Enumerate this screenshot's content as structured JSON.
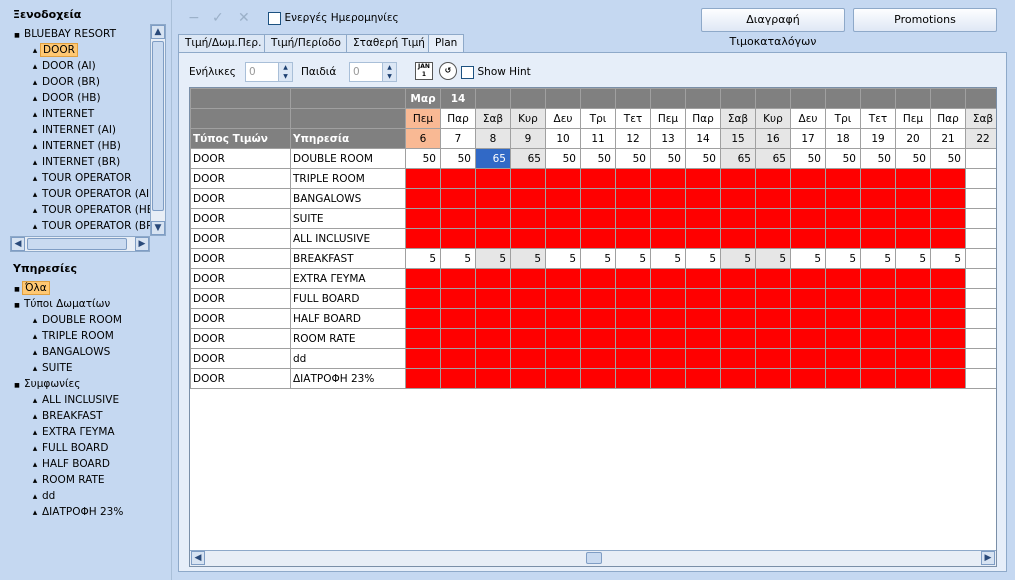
{
  "left": {
    "hotels_title": "Ξενοδοχεία",
    "hotel_tree": [
      {
        "label": "BLUEBAY RESORT",
        "level": 0,
        "selected": false
      },
      {
        "label": "DOOR",
        "level": 1,
        "selected": true
      },
      {
        "label": "DOOR (AI)",
        "level": 1,
        "selected": false
      },
      {
        "label": "DOOR (BR)",
        "level": 1,
        "selected": false
      },
      {
        "label": "DOOR (HB)",
        "level": 1,
        "selected": false
      },
      {
        "label": "INTERNET",
        "level": 1,
        "selected": false
      },
      {
        "label": "INTERNET  (AI)",
        "level": 1,
        "selected": false
      },
      {
        "label": "INTERNET  (HB)",
        "level": 1,
        "selected": false
      },
      {
        "label": "INTERNET (BR)",
        "level": 1,
        "selected": false
      },
      {
        "label": "TOUR OPERATOR",
        "level": 1,
        "selected": false
      },
      {
        "label": "TOUR OPERATOR  (AI",
        "level": 1,
        "selected": false
      },
      {
        "label": "TOUR OPERATOR  (HE",
        "level": 1,
        "selected": false
      },
      {
        "label": "TOUR OPERATOR  (BR)",
        "level": 1,
        "selected": false
      }
    ],
    "services_title": "Υπηρεσίες",
    "services_tree": [
      {
        "label": "Όλα",
        "level": 0,
        "selected": true
      },
      {
        "label": "Τύποι Δωματίων",
        "level": 0,
        "selected": false
      },
      {
        "label": "DOUBLE ROOM",
        "level": 1,
        "selected": false
      },
      {
        "label": "TRIPLE ROOM",
        "level": 1,
        "selected": false
      },
      {
        "label": "BANGALOWS",
        "level": 1,
        "selected": false
      },
      {
        "label": "SUITE",
        "level": 1,
        "selected": false
      },
      {
        "label": "Συμφωνίες",
        "level": 0,
        "selected": false
      },
      {
        "label": "ALL INCLUSIVE",
        "level": 1,
        "selected": false
      },
      {
        "label": "BREAKFAST",
        "level": 1,
        "selected": false
      },
      {
        "label": "EXTRA ΓΕΥΜΑ",
        "level": 1,
        "selected": false
      },
      {
        "label": "FULL BOARD",
        "level": 1,
        "selected": false
      },
      {
        "label": "HALF BOARD",
        "level": 1,
        "selected": false
      },
      {
        "label": "ROOM RATE",
        "level": 1,
        "selected": false
      },
      {
        "label": "dd",
        "level": 1,
        "selected": false
      },
      {
        "label": "ΔΙΑΤΡΟΦΗ 23%",
        "level": 1,
        "selected": false
      }
    ]
  },
  "toolbar": {
    "active_dates_label": "Ενεργές Ημερομηνίες",
    "delete_pricelists_label": "Διαγραφή Τιμοκαταλόγων",
    "promotions_label": "Promotions"
  },
  "tabs": [
    "Τιμή/Δωμ.Περ.",
    "Τιμή/Περίοδο",
    "Σταθερή Τιμή",
    "Plan"
  ],
  "filters": {
    "adults_label": "Ενήλικες",
    "adults_value": "0",
    "children_label": "Παιδιά",
    "children_value": "0",
    "calendar_icon_text": "JAN 1",
    "show_hint_label": "Show Hint"
  },
  "grid": {
    "month_label": "Μαρ",
    "week_label": "14",
    "col_type_header": "Τύπος Τιμών",
    "col_service_header": "Υπηρεσία",
    "days": [
      {
        "dow": "Πεμ",
        "date": "6"
      },
      {
        "dow": "Παρ",
        "date": "7"
      },
      {
        "dow": "Σαβ",
        "date": "8"
      },
      {
        "dow": "Κυρ",
        "date": "9"
      },
      {
        "dow": "Δευ",
        "date": "10"
      },
      {
        "dow": "Τρι",
        "date": "11"
      },
      {
        "dow": "Τετ",
        "date": "12"
      },
      {
        "dow": "Πεμ",
        "date": "13"
      },
      {
        "dow": "Παρ",
        "date": "14"
      },
      {
        "dow": "Σαβ",
        "date": "15"
      },
      {
        "dow": "Κυρ",
        "date": "16"
      },
      {
        "dow": "Δευ",
        "date": "17"
      },
      {
        "dow": "Τρι",
        "date": "18"
      },
      {
        "dow": "Τετ",
        "date": "19"
      },
      {
        "dow": "Πεμ",
        "date": "20"
      },
      {
        "dow": "Παρ",
        "date": "21"
      },
      {
        "dow": "Σαβ",
        "date": "22"
      }
    ],
    "rows": [
      {
        "type": "DOOR",
        "service": "DOUBLE ROOM",
        "values": [
          "50",
          "50",
          "65",
          "65",
          "50",
          "50",
          "50",
          "50",
          "50",
          "65",
          "65",
          "50",
          "50",
          "50",
          "50",
          "50",
          ""
        ]
      },
      {
        "type": "DOOR",
        "service": "TRIPLE ROOM",
        "values": null
      },
      {
        "type": "DOOR",
        "service": "BANGALOWS",
        "values": null
      },
      {
        "type": "DOOR",
        "service": "SUITE",
        "values": null
      },
      {
        "type": "DOOR",
        "service": "ALL INCLUSIVE",
        "values": null
      },
      {
        "type": "DOOR",
        "service": "BREAKFAST",
        "values": [
          "5",
          "5",
          "5",
          "5",
          "5",
          "5",
          "5",
          "5",
          "5",
          "5",
          "5",
          "5",
          "5",
          "5",
          "5",
          "5",
          ""
        ]
      },
      {
        "type": "DOOR",
        "service": "EXTRA ΓΕΥΜΑ",
        "values": null
      },
      {
        "type": "DOOR",
        "service": "FULL BOARD",
        "values": null
      },
      {
        "type": "DOOR",
        "service": "HALF BOARD",
        "values": null
      },
      {
        "type": "DOOR",
        "service": "ROOM RATE",
        "values": null
      },
      {
        "type": "DOOR",
        "service": "dd",
        "values": null
      },
      {
        "type": "DOOR",
        "service": "ΔΙΑΤΡΟΦΗ 23%",
        "values": null
      }
    ]
  },
  "colors": {
    "unavailable": "#ff0000",
    "weekend": "#e6e6e6",
    "today": "#f9b994",
    "selected_cell": "#3169c6"
  }
}
